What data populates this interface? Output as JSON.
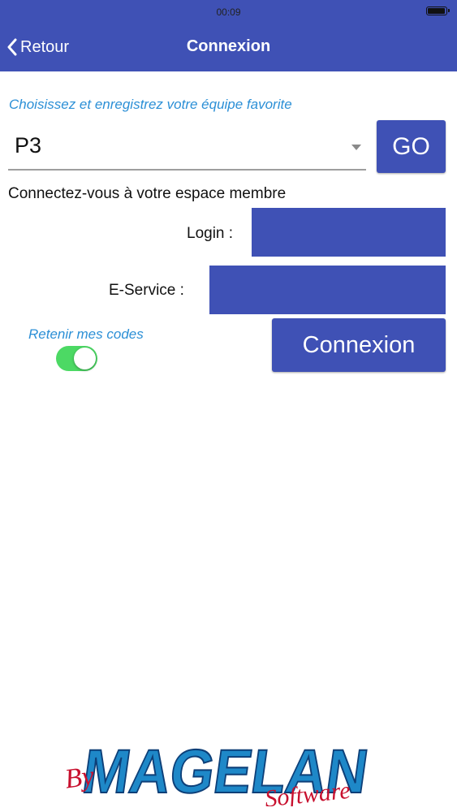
{
  "status_bar": {
    "time": "00:09"
  },
  "nav": {
    "back_label": "Retour",
    "title": "Connexion"
  },
  "team": {
    "prompt": "Choisissez et enregistrez votre équipe favorite",
    "selected_value": "P3",
    "go_label": "GO"
  },
  "member": {
    "heading": "Connectez-vous à votre espace membre",
    "login_label": "Login :",
    "login_value": "",
    "eservice_label": "E-Service :",
    "eservice_value": "",
    "remember_label": "Retenir mes codes",
    "remember_on": true,
    "connect_label": "Connexion"
  },
  "logo": {
    "by": "By",
    "name": "MAGELAN",
    "software": "Software"
  },
  "colors": {
    "accent": "#3f51b5",
    "link_blue": "#2b8fd6",
    "toggle_on": "#4cd964",
    "logo_red": "#c8102e"
  }
}
